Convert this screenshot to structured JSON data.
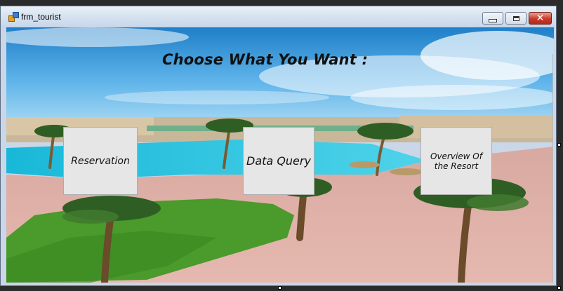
{
  "window": {
    "title": "frm_tourist"
  },
  "main": {
    "heading": "Choose What You Want :",
    "buttons": {
      "reservation": "Reservation",
      "data_query": "Data Query",
      "overview": "Overview Of the Resort"
    }
  },
  "colors": {
    "close_button": "#c73b2b",
    "button_face": "#e6e6e6",
    "sky": "#2f8fd0"
  },
  "icons": [
    "app-icon",
    "minimize-icon",
    "maximize-icon",
    "close-icon"
  ]
}
